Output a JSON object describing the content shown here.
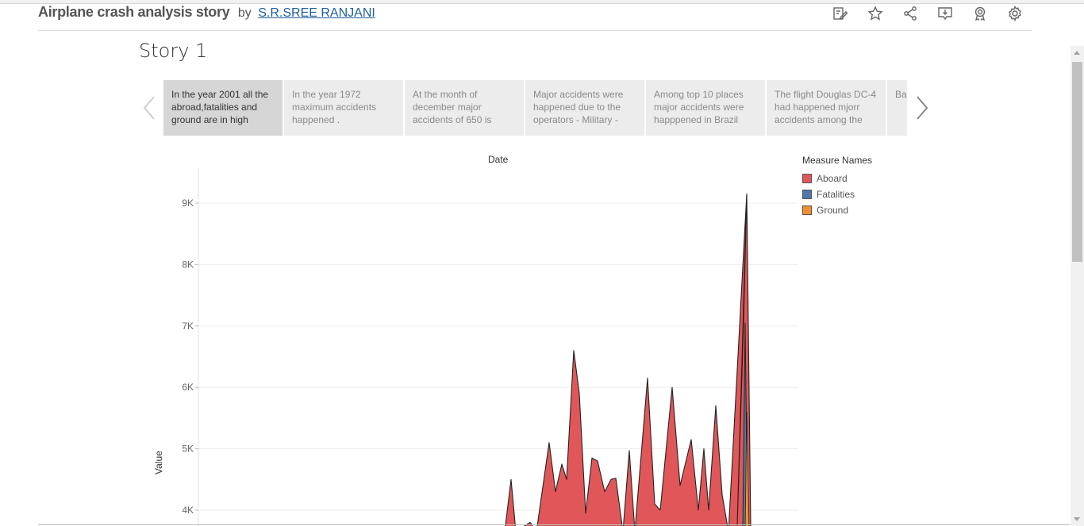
{
  "header": {
    "viz_title": "Airplane crash analysis story",
    "by": "by",
    "author": "S.R.SREE RANJANI",
    "toolbar_icons": [
      "edit-icon",
      "favorite-star-icon",
      "share-icon",
      "download-icon",
      "metrics-badge-icon",
      "settings-gear-icon"
    ]
  },
  "story": {
    "title": "Story 1",
    "points": [
      "In the year 2001 all the abroad,fatalities and ground are in high",
      "In the year 1972 maximum accidents happened .",
      "At the month of december major accidents of 650 is",
      "Major accidents were happened due to the operators - Military -",
      "Among top 10 places major accidents were happpened in Brazil",
      "The flight Douglas DC-4 had happened mjorr accidents among the",
      "Ba... ma... acc..."
    ]
  },
  "chart_data": {
    "type": "area",
    "title": "Date",
    "xlabel": "",
    "ylabel": "Value",
    "y_ticks": [
      "4K",
      "5K",
      "6K",
      "7K",
      "8K",
      "9K"
    ],
    "ylim_visible": [
      3800,
      9400
    ],
    "legend_title": "Measure Names",
    "series": [
      {
        "name": "Aboard",
        "color": "#e15759"
      },
      {
        "name": "Fatalities",
        "color": "#4e79a7"
      },
      {
        "name": "Ground",
        "color": "#f28e2b"
      }
    ],
    "aboard_visible_peaks": [
      {
        "x_index": 0,
        "value": 4500
      },
      {
        "x_index": 1,
        "value": 3800
      },
      {
        "x_index": 2,
        "value": 5100
      },
      {
        "x_index": 3,
        "value": 4300
      },
      {
        "x_index": 4,
        "value": 4750
      },
      {
        "x_index": 5,
        "value": 4500
      },
      {
        "x_index": 6,
        "value": 6600
      },
      {
        "x_index": 7,
        "value": 5900
      },
      {
        "x_index": 8,
        "value": 3950
      },
      {
        "x_index": 9,
        "value": 4850
      },
      {
        "x_index": 10,
        "value": 4800
      },
      {
        "x_index": 11,
        "value": 4300
      },
      {
        "x_index": 12,
        "value": 4500
      },
      {
        "x_index": 13,
        "value": 4520
      },
      {
        "x_index": 14,
        "value": 4970
      },
      {
        "x_index": 15,
        "value": 6150
      },
      {
        "x_index": 16,
        "value": 4100
      },
      {
        "x_index": 17,
        "value": 4000
      },
      {
        "x_index": 18,
        "value": 6000
      },
      {
        "x_index": 19,
        "value": 4400
      },
      {
        "x_index": 20,
        "value": 5150
      },
      {
        "x_index": 21,
        "value": 4000
      },
      {
        "x_index": 22,
        "value": 5000
      },
      {
        "x_index": 23,
        "value": 4000
      },
      {
        "x_index": 24,
        "value": 5700
      },
      {
        "x_index": 25,
        "value": 4250
      },
      {
        "x_index": 26,
        "value": 9150
      }
    ],
    "fatalities_peak": 7050,
    "ground_peak": 5600
  }
}
